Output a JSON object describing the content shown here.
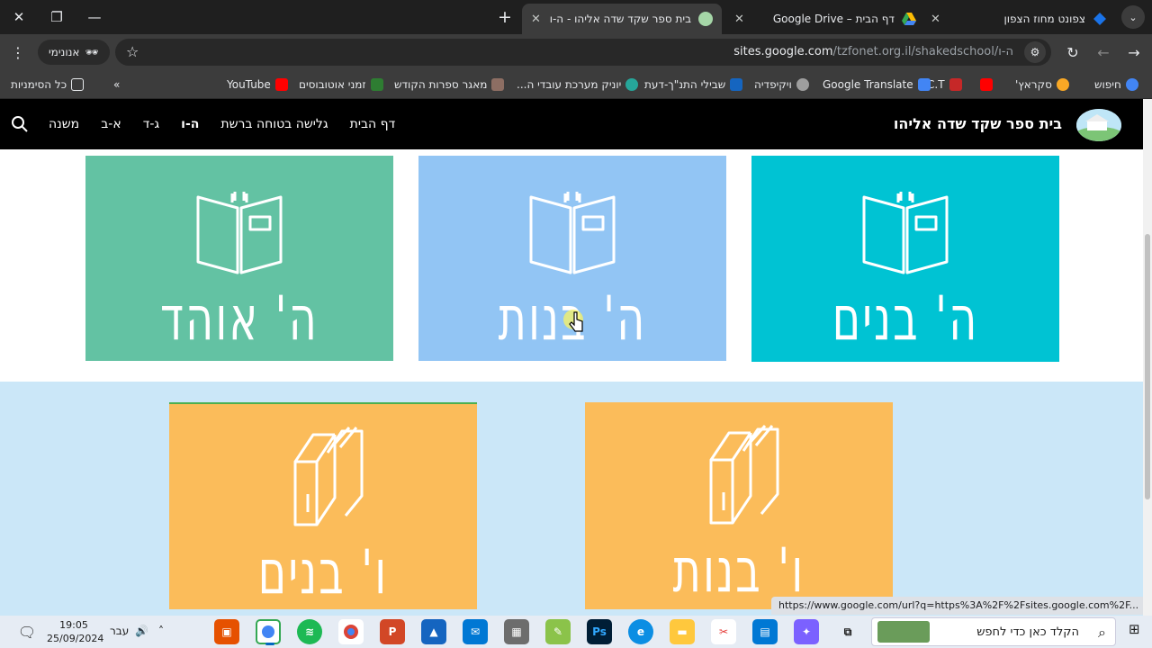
{
  "tabs": [
    {
      "label": "צפונט מחוז הצפון",
      "active": false
    },
    {
      "label": "דף הבית – Google Drive",
      "active": false
    },
    {
      "label": "בית ספר שקד שדה אליהו - ה-ו",
      "active": true
    }
  ],
  "toolbar": {
    "url_host": "sites.google.com",
    "url_path": "/tzfonet.org.il/shakedschool/ה-ו",
    "incognito_label": "אנונימי"
  },
  "bookmarks": [
    {
      "label": "חיפוש",
      "color": "#4285f4"
    },
    {
      "label": "סקראץ'",
      "color": "#f9a825"
    },
    {
      "label": "",
      "color": "#ff0000"
    },
    {
      "label": "C.T",
      "color": "#c62828"
    },
    {
      "label": "Google Translate",
      "color": "#4285f4"
    },
    {
      "label": "ויקיפדיה",
      "color": "#9e9e9e"
    },
    {
      "label": "שבילי התנ\"ך-דעת",
      "color": "#1565c0"
    },
    {
      "label": "יוניק מערכת עובדי ה...",
      "color": "#26a69a"
    },
    {
      "label": "מאגר ספרות הקודש",
      "color": "#8d6e63"
    },
    {
      "label": "זמני אוטובוסים",
      "color": "#2e7d32"
    },
    {
      "label": "YouTube",
      "color": "#ff0000"
    }
  ],
  "bookmarks_overflow": "»",
  "all_bookmarks": "כל הסימניות",
  "site": {
    "title": "בית ספר שקד שדה אליהו",
    "nav": [
      "דף הבית",
      "גלישה בטוחה ברשת",
      "ה-ו",
      "ג-ד",
      "א-ב",
      "משנה"
    ],
    "current_nav": "ה-ו"
  },
  "cards": [
    {
      "label": "ה' בנים",
      "color": "#00c3d3"
    },
    {
      "label": "ה' בנות",
      "color": "#92c5f4"
    },
    {
      "label": "ה' אוהד",
      "color": "#63c2a3"
    },
    {
      "label": "ו' בנות",
      "color": "#fbbc5a"
    },
    {
      "label": "ו' בנים",
      "color": "#fbbc5a"
    }
  ],
  "status_bubble": "https://www.google.com/url?q=https%3A%2F%2Fsites.google.com%2F...",
  "taskbar": {
    "search_placeholder": "הקלד כאן כדי לחפש",
    "time": "19:05",
    "date": "25/09/2024",
    "lang": "עבר"
  }
}
